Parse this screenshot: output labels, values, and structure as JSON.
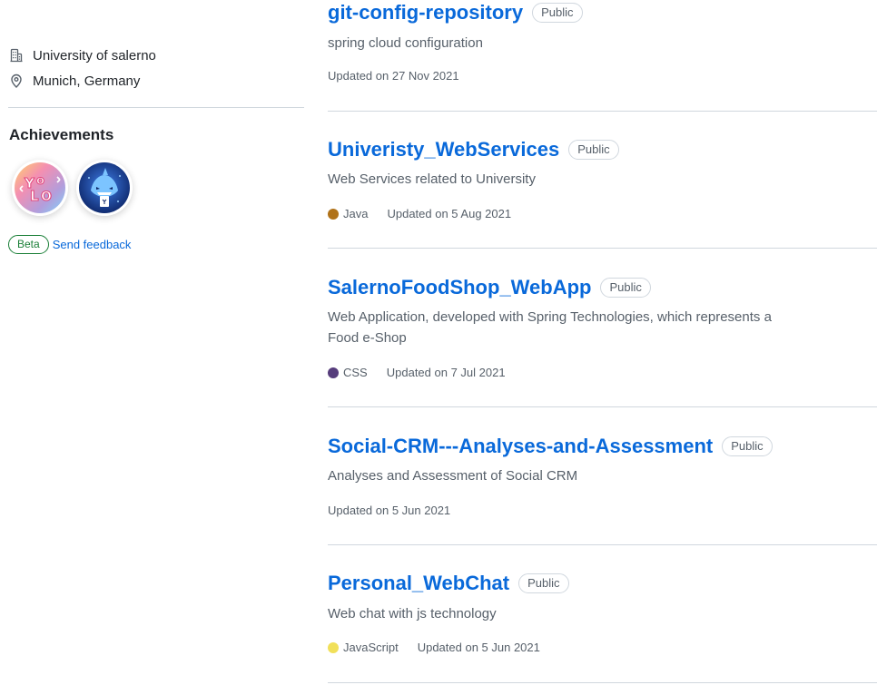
{
  "profile": {
    "organization": "University of salerno",
    "location": "Munich, Germany",
    "organization_icon": "building-icon",
    "location_icon": "location-pin-icon"
  },
  "achievements": {
    "title": "Achievements",
    "badges": [
      {
        "name": "YOLO",
        "icon": "yolo-badge-icon",
        "colors": [
          "#f8a1c4",
          "#a8e6ff",
          "#c7a6ff"
        ]
      },
      {
        "name": "Pull Shark",
        "icon": "shark-badge-icon",
        "colors": [
          "#1d3f91",
          "#4fa9f5"
        ]
      }
    ],
    "beta_label": "Beta",
    "feedback_link": "Send feedback"
  },
  "repos": [
    {
      "name": "git-config-repository",
      "visibility": "Public",
      "description": "spring cloud configuration",
      "language": "",
      "language_color": "",
      "updated": "Updated on 27 Nov 2021"
    },
    {
      "name": "Univeristy_WebServices",
      "visibility": "Public",
      "description": "Web Services related to University",
      "language": "Java",
      "language_color": "#b07219",
      "updated": "Updated on 5 Aug 2021"
    },
    {
      "name": "SalernoFoodShop_WebApp",
      "visibility": "Public",
      "description": "Web Application, developed with Spring Technologies, which represents a Food e-Shop",
      "language": "CSS",
      "language_color": "#563d7c",
      "updated": "Updated on 7 Jul 2021"
    },
    {
      "name": "Social-CRM---Analyses-and-Assessment",
      "visibility": "Public",
      "description": "Analyses and Assessment of Social CRM",
      "language": "",
      "language_color": "",
      "updated": "Updated on 5 Jun 2021"
    },
    {
      "name": "Personal_WebChat",
      "visibility": "Public",
      "description": "Web chat with js technology",
      "language": "JavaScript",
      "language_color": "#f1e05a",
      "updated": "Updated on 5 Jun 2021"
    }
  ],
  "colors": {
    "link": "#0969da",
    "muted": "#57606a",
    "border": "#d0d7de",
    "beta_green": "#1a7f37"
  }
}
